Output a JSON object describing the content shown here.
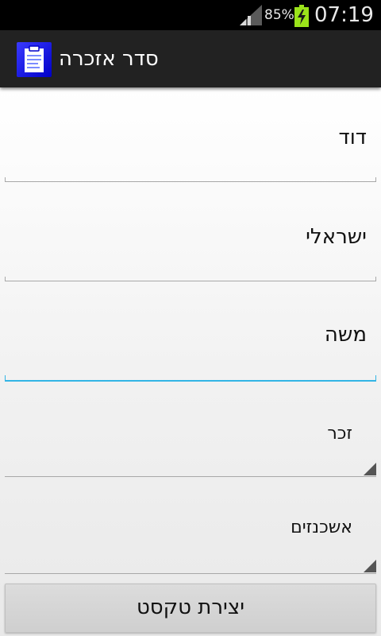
{
  "status_bar": {
    "battery_percent": "85%",
    "time": "07:19",
    "signal_icon": "signal-icon",
    "battery_icon": "battery-charging-icon"
  },
  "action_bar": {
    "title": "סדר אזכרה",
    "icon": "clipboard-icon"
  },
  "form": {
    "first_name": {
      "value": "דוד"
    },
    "last_name": {
      "value": "ישראלי"
    },
    "father_name": {
      "value": "משה"
    },
    "gender": {
      "selected": "זכר"
    },
    "community": {
      "selected": "אשכנזים"
    }
  },
  "actions": {
    "create_text_label": "יצירת טקסט"
  },
  "colors": {
    "focus_accent": "#33b5e5",
    "action_bar_bg": "#222222",
    "status_bar_bg": "#000000"
  }
}
